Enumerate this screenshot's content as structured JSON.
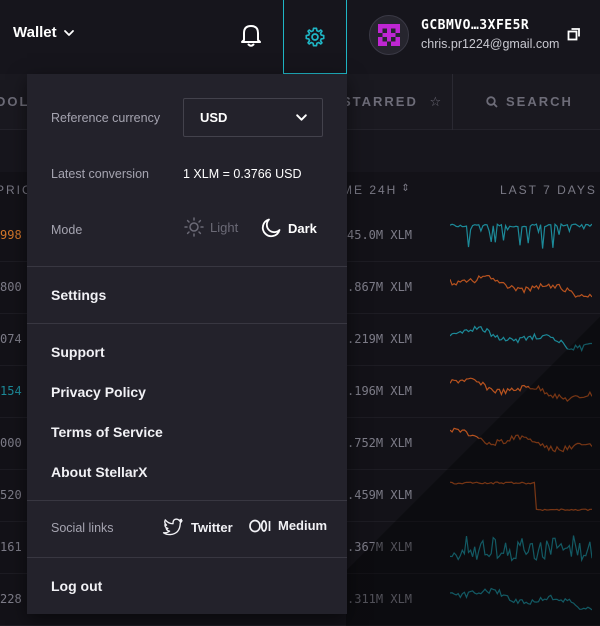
{
  "header": {
    "wallet_label": "Wallet",
    "account_id": "GCBMVO…3XFE5R",
    "account_email": "chris.pr1224@gmail.com"
  },
  "background": {
    "tabs": [
      "DOLL",
      "STARRED",
      "SEARCH"
    ],
    "columns": [
      "PRIC",
      "ME 24H",
      "LAST 7 DAYS"
    ],
    "rows": [
      {
        "left": "998",
        "left_color": "#d3762a",
        "volume": "45.0M XLM",
        "spark_color": "#1c8a99"
      },
      {
        "left": "800",
        "left_color": "#7d7c88",
        "volume": ".867M XLM",
        "spark_color": "#b9531f"
      },
      {
        "left": "074",
        "left_color": "#7d7c88",
        "volume": ".219M XLM",
        "spark_color": "#1c8a99"
      },
      {
        "left": "154",
        "left_color": "#1c8a99",
        "volume": ".196M XLM",
        "spark_color": "#b9531f"
      },
      {
        "left": "000",
        "left_color": "#7d7c88",
        "volume": ".752M XLM",
        "spark_color": "#b9531f"
      },
      {
        "left": "520",
        "left_color": "#7d7c88",
        "volume": ".459M XLM",
        "spark_color": "#b9531f"
      },
      {
        "left": "161",
        "left_color": "#7d7c88",
        "volume": ".367M XLM",
        "spark_color": "#1c8a99"
      },
      {
        "left": "228",
        "left_color": "#7d7c88",
        "volume": ".311M XLM",
        "spark_color": "#1c8a99"
      }
    ]
  },
  "menu": {
    "reference_currency_label": "Reference currency",
    "reference_currency_value": "USD",
    "latest_conversion_label": "Latest conversion",
    "latest_conversion_value": "1 XLM = 0.3766 USD",
    "mode_label": "Mode",
    "mode_light": "Light",
    "mode_dark": "Dark",
    "mode_selected": "Dark",
    "settings": "Settings",
    "support": "Support",
    "privacy_policy": "Privacy Policy",
    "terms_of_service": "Terms of Service",
    "about": "About StellarX",
    "social_links_label": "Social links",
    "twitter": "Twitter",
    "medium": "Medium",
    "logout": "Log out"
  },
  "colors": {
    "accent": "#1fb6c5",
    "menu_bg": "#23222b",
    "topbar_bg": "#16151c",
    "avatar_accent": "#c026d3"
  },
  "icons": [
    "chevron-down-icon",
    "bell-icon",
    "gear-icon",
    "identicon",
    "copy-icon",
    "sun-icon",
    "moon-icon",
    "twitter-icon",
    "medium-icon",
    "search-icon",
    "star-icon",
    "sort-icon"
  ]
}
